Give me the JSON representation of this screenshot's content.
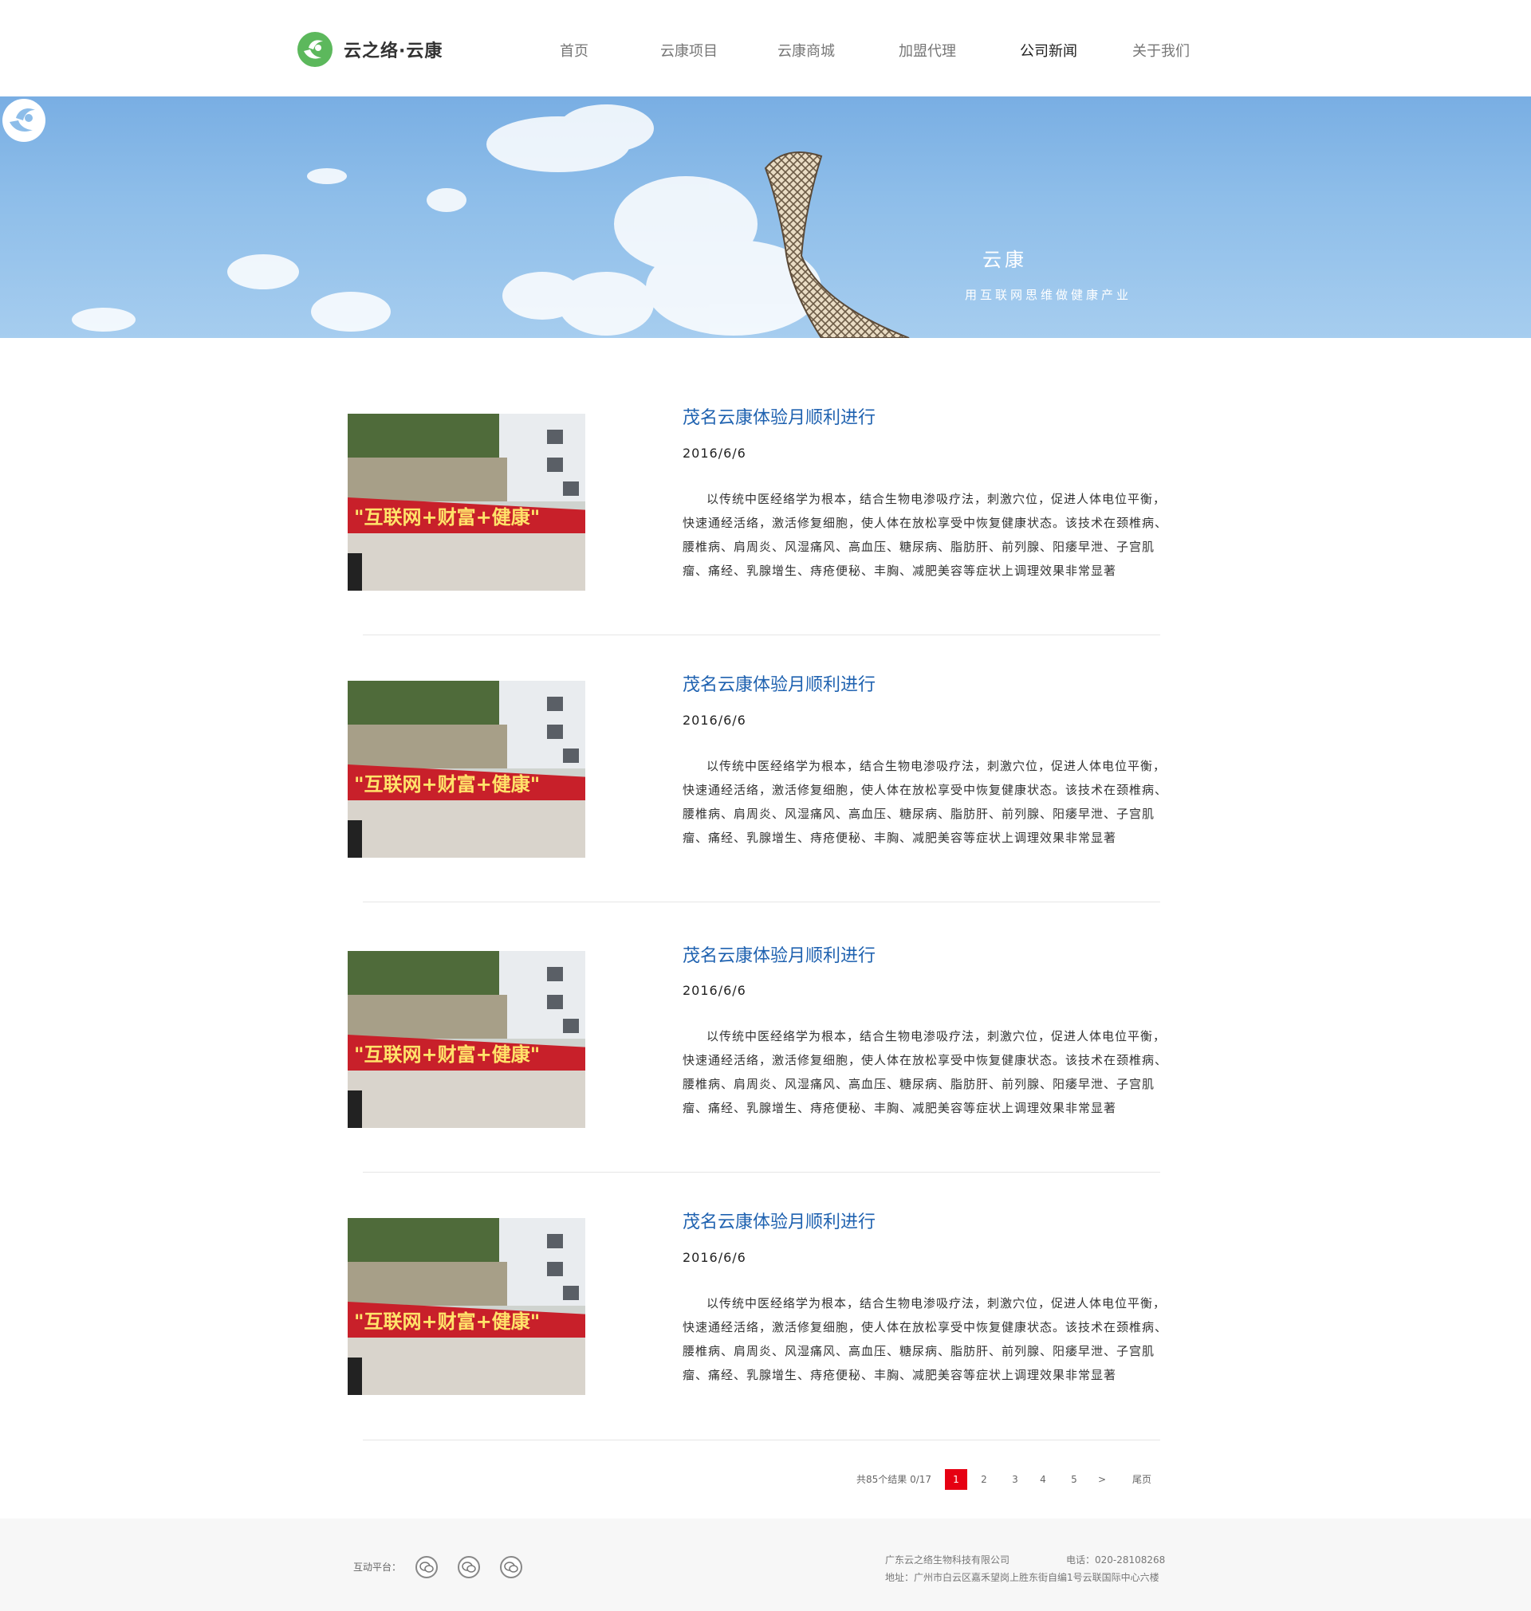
{
  "brand": {
    "logo_text": "云之络·云康",
    "accent_green": "#5cb85c"
  },
  "nav": {
    "items": [
      {
        "label": "首页"
      },
      {
        "label": "云康项目"
      },
      {
        "label": "云康商城"
      },
      {
        "label": "加盟代理"
      },
      {
        "label": "公司新闻"
      },
      {
        "label": "关于我们"
      }
    ],
    "active": "公司新闻"
  },
  "banner": {
    "brand_text": "云康",
    "slogan": "用互联网思维做健康产业"
  },
  "news": {
    "items": [
      {
        "title": "茂名云康体验月顺利进行",
        "date": "2016/6/6",
        "body": "以传统中医经络学为根本，结合生物电渗吸疗法，刺激穴位，促进人体电位平衡，快速通经活络，激活修复细胞，使人体在放松享受中恢复健康状态。该技术在颈椎病、腰椎病、肩周炎、风湿痛风、高血压、糖尿病、脂肪肝、前列腺、阳痿早泄、子宫肌瘤、痛经、乳腺增生、痔疮便秘、丰胸、减肥美容等症状上调理效果非常显著",
        "banner_text": "\"互联网+财富+健康\""
      },
      {
        "title": "茂名云康体验月顺利进行",
        "date": "2016/6/6",
        "body": "以传统中医经络学为根本，结合生物电渗吸疗法，刺激穴位，促进人体电位平衡，快速通经活络，激活修复细胞，使人体在放松享受中恢复健康状态。该技术在颈椎病、腰椎病、肩周炎、风湿痛风、高血压、糖尿病、脂肪肝、前列腺、阳痿早泄、子宫肌瘤、痛经、乳腺增生、痔疮便秘、丰胸、减肥美容等症状上调理效果非常显著",
        "banner_text": "\"互联网+财富+健康\""
      },
      {
        "title": "茂名云康体验月顺利进行",
        "date": "2016/6/6",
        "body": "以传统中医经络学为根本，结合生物电渗吸疗法，刺激穴位，促进人体电位平衡，快速通经活络，激活修复细胞，使人体在放松享受中恢复健康状态。该技术在颈椎病、腰椎病、肩周炎、风湿痛风、高血压、糖尿病、脂肪肝、前列腺、阳痿早泄、子宫肌瘤、痛经、乳腺增生、痔疮便秘、丰胸、减肥美容等症状上调理效果非常显著",
        "banner_text": "\"互联网+财富+健康\""
      },
      {
        "title": "茂名云康体验月顺利进行",
        "date": "2016/6/6",
        "body": "以传统中医经络学为根本，结合生物电渗吸疗法，刺激穴位，促进人体电位平衡，快速通经活络，激活修复细胞，使人体在放松享受中恢复健康状态。该技术在颈椎病、腰椎病、肩周炎、风湿痛风、高血压、糖尿病、脂肪肝、前列腺、阳痿早泄、子宫肌瘤、痛经、乳腺增生、痔疮便秘、丰胸、减肥美容等症状上调理效果非常显著",
        "banner_text": "\"互联网+财富+健康\""
      }
    ]
  },
  "pagination": {
    "info": "共85个结果 0/17",
    "pages": [
      "1",
      "2",
      "3",
      "4",
      "5"
    ],
    "current": "1",
    "next": ">",
    "last": "尾页",
    "current_color": "#e60012"
  },
  "footer": {
    "platform_label": "互动平台：",
    "social_icons": [
      "wechat-icon",
      "wechat-icon",
      "wechat-icon"
    ],
    "company": "广东云之络生物科技有限公司",
    "phone": "电话：020-28108268",
    "address": "地址：广州市白云区嘉禾望岗上胜东街自编1号云联国际中心六楼"
  }
}
